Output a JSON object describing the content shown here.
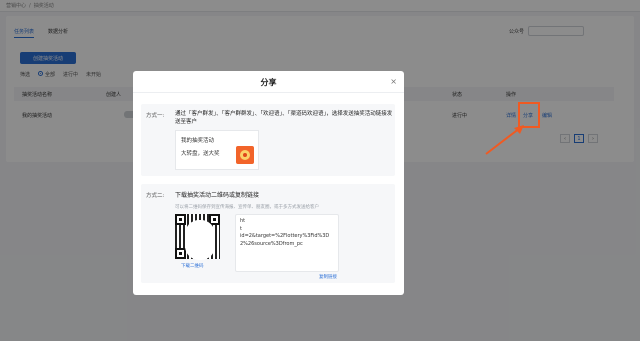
{
  "breadcrumb": {
    "root": "营销中心",
    "sep": "/",
    "current": "抽奖活动"
  },
  "tabs": [
    "任务列表",
    "数据分析"
  ],
  "account": {
    "label": "公众号"
  },
  "create_button": "创建抽奖活动",
  "filter": {
    "label": "筛选",
    "options": [
      "全部",
      "进行中",
      "未开始"
    ]
  },
  "table": {
    "columns": [
      "抽奖活动名称",
      "创建人",
      "状态",
      "操作"
    ],
    "rows": [
      {
        "name": "我的抽奖活动",
        "status": "进行中",
        "ops": {
          "detail": "详情",
          "share": "分享",
          "edit": "编辑"
        }
      }
    ]
  },
  "pagination": {
    "prev": "‹",
    "current": "1",
    "next": "›"
  },
  "modal": {
    "title": "分享",
    "close": "×",
    "method1": {
      "label": "方式一:",
      "desc": "通过「客户群发」、「客户群群发」、「欢迎语」、「渠道码欢迎语」，选择发送抽奖活动链接发送至客户",
      "preview_title": "我的抽奖活动",
      "preview_sub": "大转盘，送大奖"
    },
    "method2": {
      "label": "方式二:",
      "title": "下载抽奖活动二维码或复制链接",
      "hint": "可以将二维码保存到宣传海报、宣传单、朋友圈，或于多方式发送给客户",
      "download": "下载二维码",
      "url": "ht\nt\nid=2&target=%2Flottery%3Fid%3D2%26source%3Dfrom_pc",
      "copy": "复制链接"
    }
  },
  "colors": {
    "accent": "#2b6fd6",
    "highlight": "#f05a22"
  }
}
